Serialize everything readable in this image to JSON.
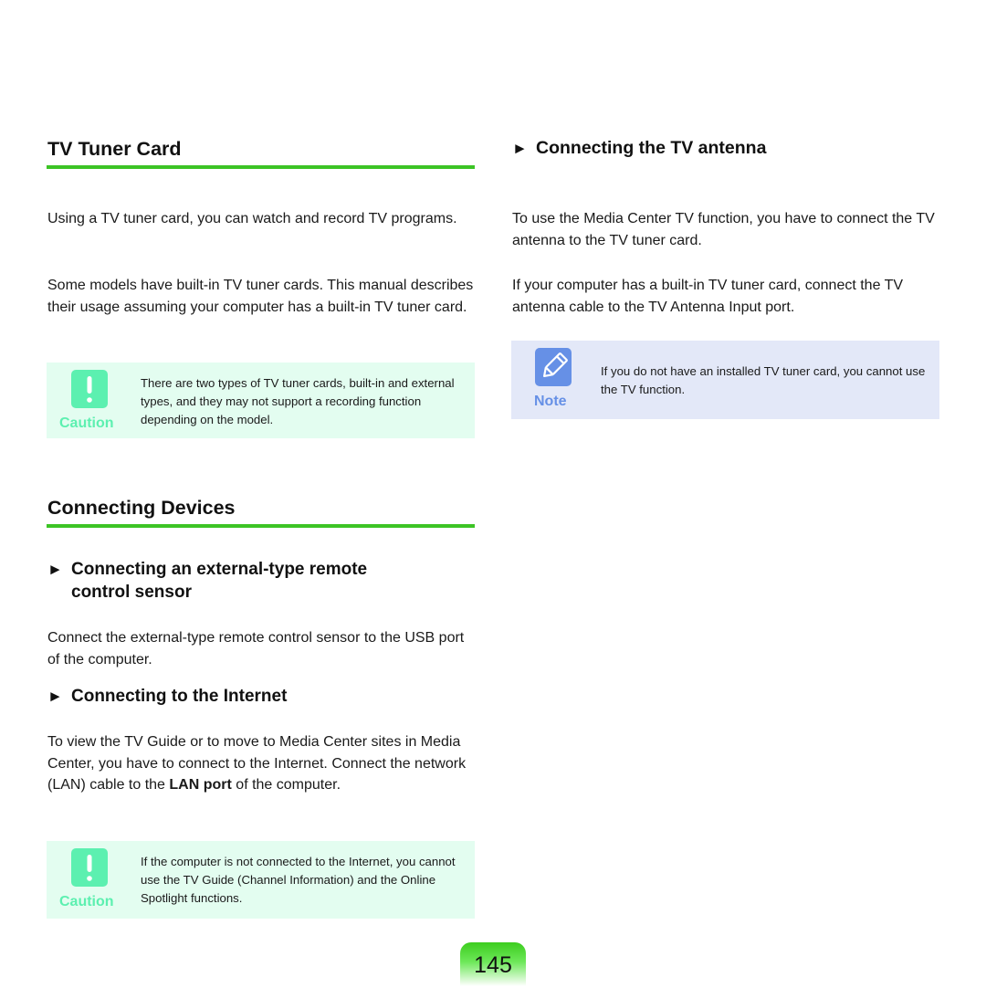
{
  "left": {
    "tv_tuner": {
      "title": "TV Tuner Card",
      "paragraphs": [
        "Using a TV tuner card, you can watch and record TV programs.",
        "Some models have built-in TV tuner cards. This manual describes their usage assuming your computer has a built-in TV tuner card."
      ],
      "caution": {
        "label": "Caution",
        "icon": "exclamation-icon",
        "text": "There are two types of TV tuner cards, built-in and external types, and they may not support a recording function depending on the model."
      }
    },
    "connecting_devices": {
      "title": "Connecting Devices",
      "remote_sensor": {
        "arrow": "►",
        "title_line1": "Connecting an external-type remote",
        "title_line2": "control sensor",
        "paragraph": "Connect the external-type remote control sensor to the USB port of the computer."
      },
      "internet": {
        "arrow": "►",
        "title": "Connecting to the Internet",
        "paragraph_pre": "To view the TV Guide or to move to Media Center sites in Media Center, you have to connect to the Internet. Connect the network (LAN) cable to the ",
        "paragraph_bold": "LAN port",
        "paragraph_post": " of the computer.",
        "caution": {
          "label": "Caution",
          "icon": "exclamation-icon",
          "text": "If the computer is not connected to the Internet, you cannot use the TV Guide (Channel Information) and the Online Spotlight functions."
        }
      }
    }
  },
  "right": {
    "antenna": {
      "arrow": "►",
      "title": "Connecting the TV antenna",
      "paragraphs": [
        "To use the Media Center TV function, you have to connect the TV antenna to the TV tuner card.",
        "If your computer has a built-in TV tuner card, connect the TV antenna cable to the TV Antenna Input port."
      ],
      "note": {
        "label": "Note",
        "icon": "pencil-icon",
        "text": "If you do not have an installed TV tuner card, you cannot use the TV function."
      }
    }
  },
  "page_number": "145",
  "colors": {
    "accent_green": "#3cc425",
    "caution_bg": "#e3fdf0",
    "caution_icon": "#5cf0b0",
    "note_bg": "#e3e8f8",
    "note_icon": "#6690e6"
  }
}
